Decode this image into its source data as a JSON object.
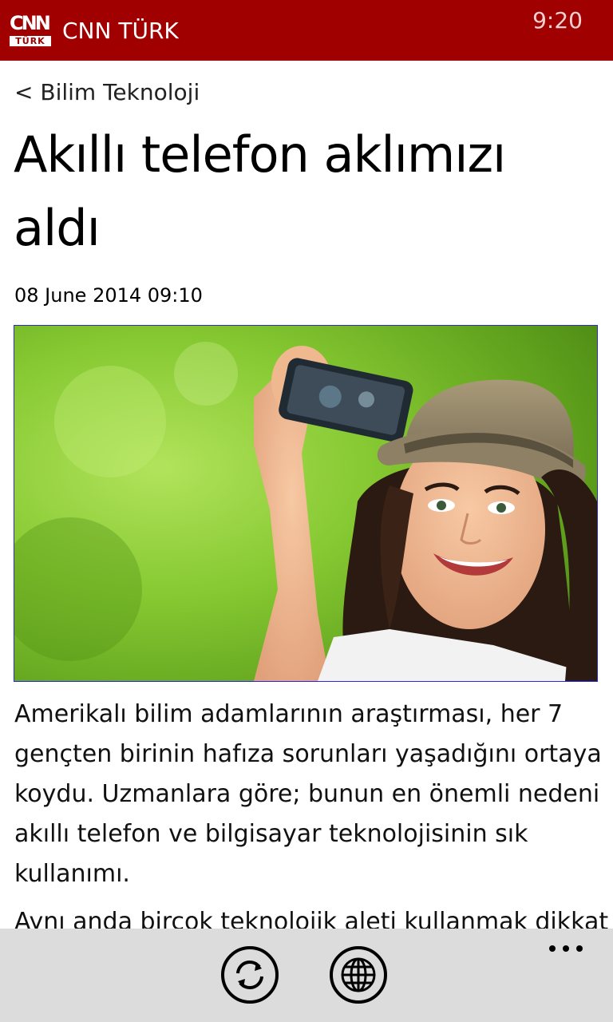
{
  "header": {
    "logo_top": "CNN",
    "logo_bottom": "TÜRK",
    "app_title": "CNN TÜRK",
    "clock": "9:20",
    "background_color": "#a00000"
  },
  "article": {
    "breadcrumb": "< Bilim Teknoloji",
    "title": "Akıllı telefon aklımızı aldı",
    "date": "08 June 2014 09:10",
    "image_icon": "selfie-photo",
    "paragraphs": [
      "Amerikalı bilim adamlarının araştırması, her 7 gençten birinin hafıza sorunları yaşadığını ortaya koydu. Uzmanlara göre; bunun en önemli nedeni akıllı telefon ve bilgisayar teknolojisinin sık kullanımı.",
      "Aynı anda birçok teknolojik aleti kullanmak dikkat"
    ]
  },
  "appbar": {
    "buttons": [
      {
        "icon": "refresh-icon"
      },
      {
        "icon": "globe-icon"
      }
    ],
    "more_icon": "ellipsis-icon",
    "background_color": "#dcdcdc"
  }
}
